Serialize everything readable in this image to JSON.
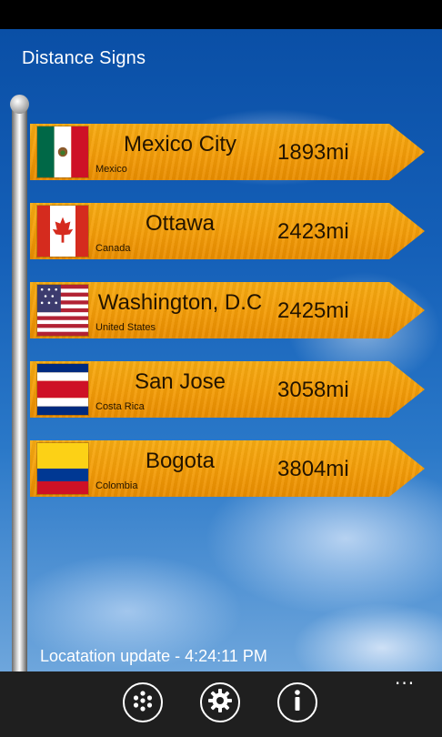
{
  "app": {
    "title": "Distance Signs"
  },
  "signs": [
    {
      "city": "Mexico City",
      "country": "Mexico",
      "distance": "1893mi",
      "flag": "mexico-flag-icon"
    },
    {
      "city": "Ottawa",
      "country": "Canada",
      "distance": "2423mi",
      "flag": "canada-flag-icon"
    },
    {
      "city": "Washington, D.C",
      "country": "United States",
      "distance": "2425mi",
      "flag": "usa-flag-icon"
    },
    {
      "city": "San Jose",
      "country": "Costa Rica",
      "distance": "3058mi",
      "flag": "costa-rica-flag-icon"
    },
    {
      "city": "Bogota",
      "country": "Colombia",
      "distance": "3804mi",
      "flag": "colombia-flag-icon"
    }
  ],
  "footer": {
    "status": "Locatation update - 4:24:11 PM"
  },
  "appbar": {
    "buttons": [
      {
        "icon": "dots-grid-icon"
      },
      {
        "icon": "gear-icon"
      },
      {
        "icon": "info-icon"
      }
    ],
    "more": "..."
  },
  "colors": {
    "sign": "#f39c08",
    "appbar": "#1f1f1f",
    "sky": "#1560b8"
  }
}
